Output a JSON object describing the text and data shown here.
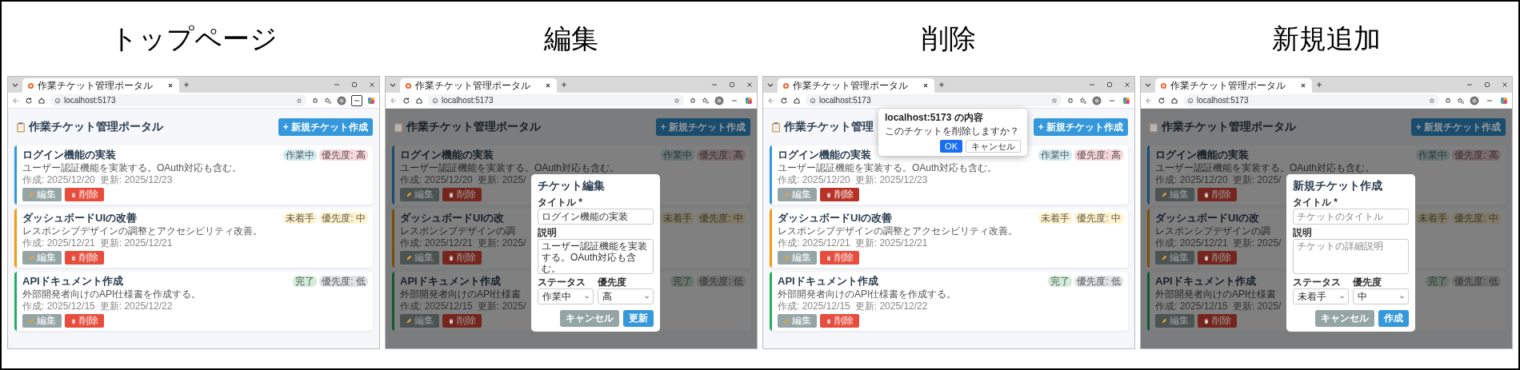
{
  "panels": [
    {
      "heading": "トップページ",
      "kind": "list",
      "browser": {
        "tab_title": "作業チケット管理ポータル",
        "url": "localhost:5173",
        "menu_focused": true
      },
      "page": {
        "title": "作業チケット管理ポータル",
        "new_button": "+ 新規チケット作成",
        "tickets": [
          {
            "title": "ログイン機能の実装",
            "description": "ユーザー認証機能を実装する。OAuth対応も含む。",
            "created": "作成: 2025/12/20",
            "updated": "更新: 2025/12/23",
            "color": "#3498db",
            "badges": [
              {
                "text": "作業中",
                "color": "#d1ecf1"
              },
              {
                "text": "優先度: 高",
                "color": "#f8d7da"
              }
            ],
            "edit_label": "編集",
            "delete_label": "削除",
            "delete_pressed": false
          },
          {
            "title": "ダッシュボードUIの改善",
            "description": "レスポンシブデザインの調整とアクセシビリティ改善。",
            "created": "作成: 2025/12/21",
            "updated": "更新: 2025/12/21",
            "color": "#f39c12",
            "badges": [
              {
                "text": "未着手",
                "color": "#fff3cd"
              },
              {
                "text": "優先度: 中",
                "color": "#fff3cd"
              }
            ],
            "edit_label": "編集",
            "delete_label": "削除",
            "delete_pressed": false
          },
          {
            "title": "APIドキュメント作成",
            "description": "外部開発者向けのAPI仕様書を作成する。",
            "created": "作成: 2025/12/15",
            "updated": "更新: 2025/12/22",
            "color": "#27ae60",
            "badges": [
              {
                "text": "完了",
                "color": "#d4edda"
              },
              {
                "text": "優先度: 低",
                "color": "#e2e3e5"
              }
            ],
            "edit_label": "編集",
            "delete_label": "削除",
            "delete_pressed": false
          }
        ]
      }
    },
    {
      "heading": "編集",
      "kind": "form",
      "browser": {
        "tab_title": "作業チケット管理ポータル",
        "url": "localhost:5173",
        "menu_focused": false
      },
      "page": {
        "title": "作業チケット管理ポータル",
        "new_button": "+ 新規チケット作成",
        "tickets": [
          {
            "title": "ログイン機能の実装",
            "description": "ユーザー認証機能を実装する。OAuth対応も含む。",
            "created": "作成: 2025/12/20",
            "updated": "更新: 2025/",
            "color": "#1a4c6e",
            "badges": [
              {
                "text": "作業中",
                "color": "#687678"
              },
              {
                "text": "優先度: 高",
                "color": "#7c6b6d"
              }
            ],
            "edit_label": "編集",
            "delete_label": "削除",
            "delete_pressed": false
          },
          {
            "title": "ダッシュボードUIの改",
            "description": "レスポンシブデザインの調",
            "created": "作成: 2025/12/21",
            "updated": "更新: 2025/",
            "color": "#794e09",
            "badges": [
              {
                "text": "未着手",
                "color": "#7f7966"
              },
              {
                "text": "優先度: 中",
                "color": "#7f7966"
              }
            ],
            "edit_label": "編集",
            "delete_label": "削除",
            "delete_pressed": false
          },
          {
            "title": "APIドキュメント作成",
            "description": "外部開発者向けのAPI仕様書",
            "created": "作成: 2025/12/15",
            "updated": "更新: 2025/",
            "color": "#135730",
            "badges": [
              {
                "text": "完了",
                "color": "#6a766d"
              },
              {
                "text": "優先度: 低",
                "color": "#717172"
              }
            ],
            "edit_label": "編集",
            "delete_label": "削除",
            "delete_pressed": false
          }
        ]
      },
      "dialog": {
        "title": "チケット編集",
        "fields": [
          {
            "kind": "input",
            "label": "タイトル *",
            "value": "ログイン機能の実装"
          },
          {
            "kind": "textarea",
            "label": "説明",
            "value": "ユーザー認証機能を実装する。OAuth対応も含む。"
          },
          {
            "kind": "select",
            "label": "ステータス",
            "value": "作業中"
          },
          {
            "kind": "select",
            "label": "優先度",
            "value": "高"
          }
        ],
        "buttons": [
          {
            "label": "キャンセル",
            "kind": "secondary"
          },
          {
            "label": "更新",
            "kind": "primary"
          }
        ]
      }
    },
    {
      "heading": "削除",
      "kind": "confirm",
      "browser": {
        "tab_title": "作業チケット管理ポータル",
        "url": "localhost:5173",
        "menu_focused": false
      },
      "page": {
        "title": "作業チケット管理",
        "new_button": "+ 新規チケット作成",
        "tickets": [
          {
            "title": "ログイン機能の実装",
            "description": "ユーザー認証機能を実装する。OAuth対応も含む。",
            "created": "作成: 2025/12/20",
            "updated": "更新: 2025/12/23",
            "color": "#3498db",
            "badges": [
              {
                "text": "作業中",
                "color": "#d1ecf1"
              },
              {
                "text": "優先度: 高",
                "color": "#f8d7da"
              }
            ],
            "edit_label": "編集",
            "delete_label": "削除",
            "delete_pressed": true
          },
          {
            "title": "ダッシュボードUIの改善",
            "description": "レスポンシブデザインの調整とアクセシビリティ改善。",
            "created": "作成: 2025/12/21",
            "updated": "更新: 2025/12/21",
            "color": "#f39c12",
            "badges": [
              {
                "text": "未着手",
                "color": "#fff3cd"
              },
              {
                "text": "優先度: 中",
                "color": "#fff3cd"
              }
            ],
            "edit_label": "編集",
            "delete_label": "削除",
            "delete_pressed": false
          },
          {
            "title": "APIドキュメント作成",
            "description": "外部開発者向けのAPI仕様書を作成する。",
            "created": "作成: 2025/12/15",
            "updated": "更新: 2025/12/22",
            "color": "#27ae60",
            "badges": [
              {
                "text": "完了",
                "color": "#d4edda"
              },
              {
                "text": "優先度: 低",
                "color": "#e2e3e5"
              }
            ],
            "edit_label": "編集",
            "delete_label": "削除",
            "delete_pressed": false
          }
        ]
      },
      "dialog": {
        "title": "localhost:5173 の内容",
        "message": "このチケットを削除しますか？",
        "buttons": [
          {
            "label": "OK",
            "kind": "primary"
          },
          {
            "label": "キャンセル",
            "kind": "secondary"
          }
        ]
      }
    },
    {
      "heading": "新規追加",
      "kind": "form",
      "browser": {
        "tab_title": "作業チケット管理ポータル",
        "url": "localhost:5173",
        "menu_focused": false
      },
      "page": {
        "title": "作業チケット管理ポータル",
        "new_button": "+ 新規チケット作成",
        "tickets": [
          {
            "title": "ログイン機能の実装",
            "description": "ユーザー認証機能を実装する。OAuth対応も含む。",
            "created": "作成: 2025/12/20",
            "updated": "更新: 2025/",
            "color": "#1a4c6e",
            "badges": [
              {
                "text": "作業中",
                "color": "#687678"
              },
              {
                "text": "優先度: 高",
                "color": "#7c6b6d"
              }
            ],
            "edit_label": "編集",
            "delete_label": "削除",
            "delete_pressed": false
          },
          {
            "title": "ダッシュボードUIの改",
            "description": "レスポンシブデザインの調",
            "created": "作成: 2025/12/21",
            "updated": "更新: 2025/",
            "color": "#794e09",
            "badges": [
              {
                "text": "未着手",
                "color": "#7f7966"
              },
              {
                "text": "優先度: 中",
                "color": "#7f7966"
              }
            ],
            "edit_label": "編集",
            "delete_label": "削除",
            "delete_pressed": false
          },
          {
            "title": "APIドキュメント作成",
            "description": "外部開発者向けのAPI仕様書",
            "created": "作成: 2025/12/15",
            "updated": "更新: 2025/",
            "color": "#135730",
            "badges": [
              {
                "text": "完了",
                "color": "#6a766d"
              },
              {
                "text": "優先度: 低",
                "color": "#717172"
              }
            ],
            "edit_label": "編集",
            "delete_label": "削除",
            "delete_pressed": false
          }
        ]
      },
      "dialog": {
        "title": "新規チケット作成",
        "fields": [
          {
            "kind": "input",
            "label": "タイトル *",
            "placeholder": "チケットのタイトル"
          },
          {
            "kind": "textarea",
            "label": "説明",
            "placeholder": "チケットの詳細説明"
          },
          {
            "kind": "select",
            "label": "ステータス",
            "value": "未着手"
          },
          {
            "kind": "select",
            "label": "優先度",
            "value": "中"
          }
        ],
        "buttons": [
          {
            "label": "キャンセル",
            "kind": "secondary"
          },
          {
            "label": "作成",
            "kind": "primary"
          }
        ]
      }
    }
  ]
}
